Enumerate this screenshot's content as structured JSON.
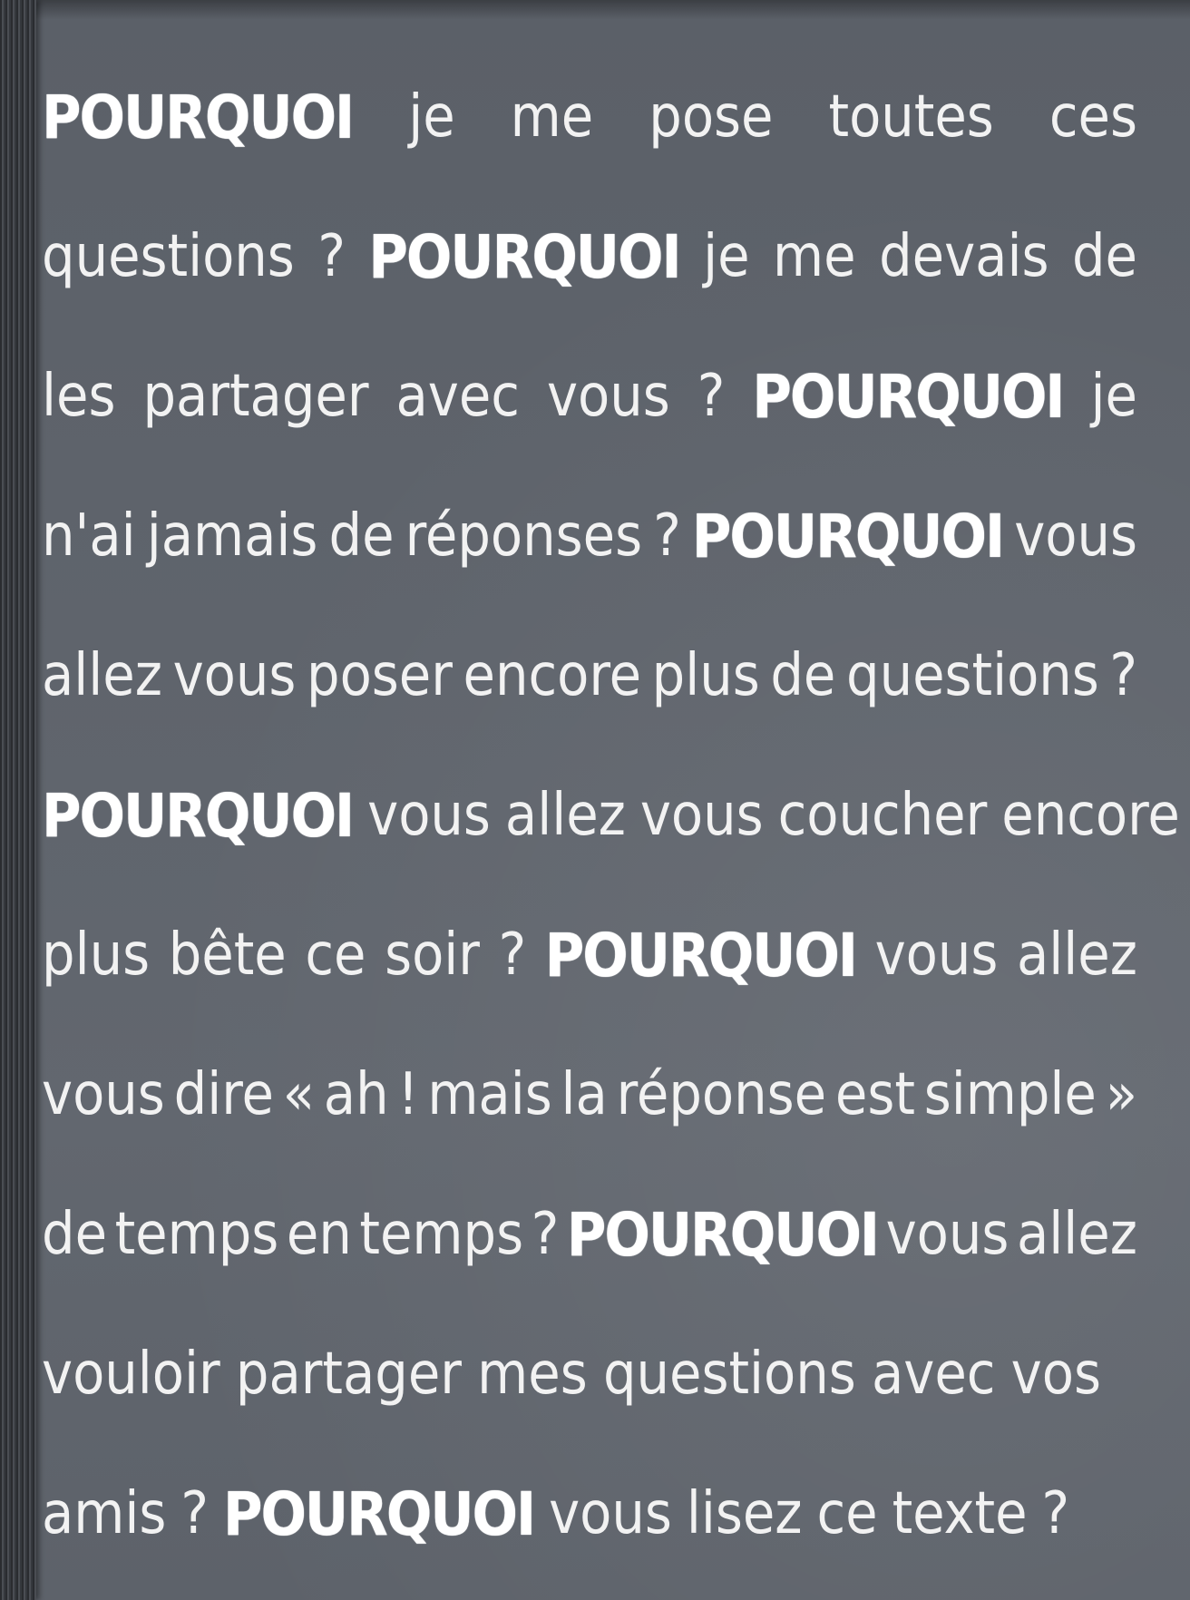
{
  "keyword": "POURQUOI",
  "lines": [
    [
      "je",
      "me",
      "pose",
      "toutes",
      "ces"
    ],
    [
      "questions",
      "?",
      "je",
      "me",
      "devais",
      "de"
    ],
    [
      "les",
      "partager",
      "avec",
      "vous",
      "?",
      "je"
    ],
    [
      "n'ai",
      "jamais",
      "de",
      "réponses",
      "?",
      "vous"
    ],
    [
      "allez",
      "vous",
      "poser",
      "encore",
      "plus",
      "de",
      "questions",
      "?"
    ],
    [
      "vous",
      "allez",
      "vous",
      "coucher",
      "encore"
    ],
    [
      "plus",
      "bête",
      "ce",
      "soir",
      "?",
      "vous",
      "allez"
    ],
    [
      "vous",
      "dire",
      "«",
      "ah",
      "!",
      "mais",
      "la",
      "réponse",
      "est",
      "simple",
      "»"
    ],
    [
      "de",
      "temps",
      "en",
      "temps",
      "?",
      "vous",
      "allez"
    ],
    [
      "vouloir",
      "partager",
      "mes",
      "questions",
      "avec",
      "vos"
    ],
    [
      "amis",
      "?",
      "vous",
      "lisez",
      "ce",
      "texte",
      "?"
    ]
  ]
}
